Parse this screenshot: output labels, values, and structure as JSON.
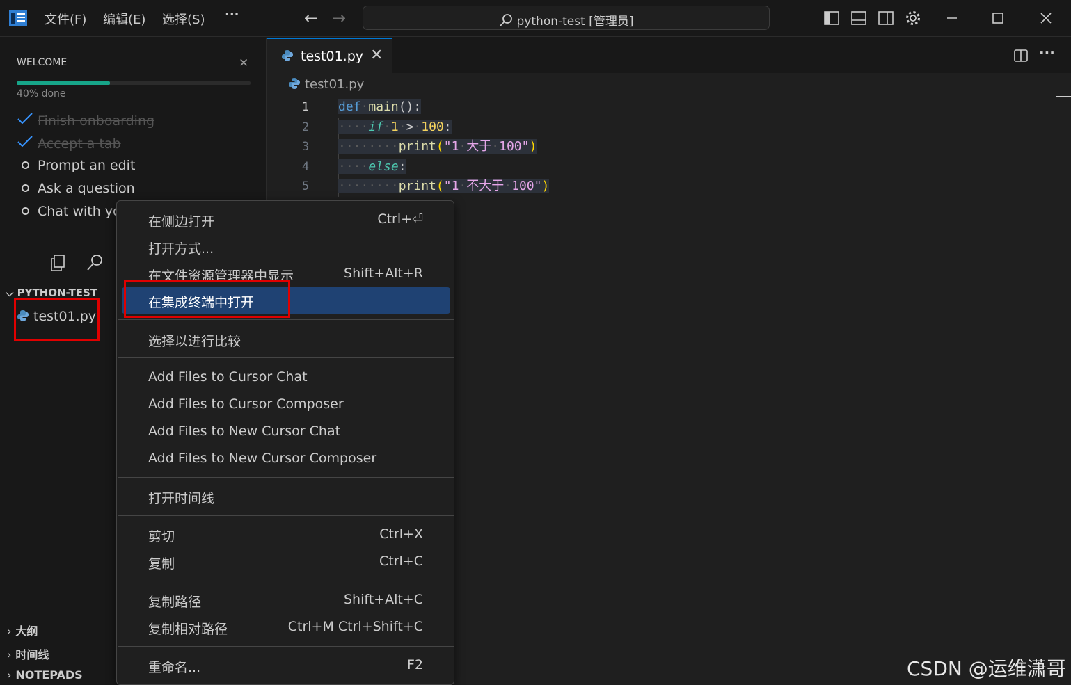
{
  "titlebar": {
    "menus": [
      "文件(F)",
      "编辑(E)",
      "选择(S)",
      "···"
    ],
    "search_text": "python-test [管理员]"
  },
  "sidebar": {
    "welcome": {
      "title": "WELCOME",
      "progress_text": "40% done",
      "progress_value": 0.4,
      "items": [
        {
          "label": "Finish onboarding",
          "done": true
        },
        {
          "label": "Accept a tab",
          "done": true
        },
        {
          "label": "Prompt an edit",
          "done": false
        },
        {
          "label": "Ask a question",
          "done": false
        },
        {
          "label": "Chat with you",
          "done": false
        }
      ]
    },
    "explorer": {
      "folder": "PYTHON-TEST",
      "file": "test01.py"
    },
    "sections": [
      "大纲",
      "时间线",
      "NOTEPADS"
    ]
  },
  "editor": {
    "tab_label": "test01.py",
    "breadcrumb": "test01.py",
    "line_numbers": [
      "1",
      "2",
      "3",
      "4",
      "5"
    ]
  },
  "context_menu": {
    "items": [
      {
        "label": "在侧边打开",
        "shortcut": "Ctrl+⏎"
      },
      {
        "label": "打开方式...",
        "shortcut": ""
      },
      {
        "label": "在文件资源管理器中显示",
        "shortcut": "Shift+Alt+R"
      },
      {
        "label": "在集成终端中打开",
        "shortcut": ""
      },
      {
        "label": "选择以进行比较",
        "shortcut": ""
      },
      {
        "label": "Add Files to Cursor Chat",
        "shortcut": ""
      },
      {
        "label": "Add Files to Cursor Composer",
        "shortcut": ""
      },
      {
        "label": "Add Files to New Cursor Chat",
        "shortcut": ""
      },
      {
        "label": "Add Files to New Cursor Composer",
        "shortcut": ""
      },
      {
        "label": "打开时间线",
        "shortcut": ""
      },
      {
        "label": "剪切",
        "shortcut": "Ctrl+X"
      },
      {
        "label": "复制",
        "shortcut": "Ctrl+C"
      },
      {
        "label": "复制路径",
        "shortcut": "Shift+Alt+C"
      },
      {
        "label": "复制相对路径",
        "shortcut": "Ctrl+M Ctrl+Shift+C"
      },
      {
        "label": "重命名...",
        "shortcut": "F2"
      }
    ]
  },
  "watermark": "CSDN @运维潇哥",
  "colors": {
    "accent": "#0078d4",
    "selection": "#1f4273",
    "progress": "#17a589",
    "annotation": "#e00000"
  }
}
